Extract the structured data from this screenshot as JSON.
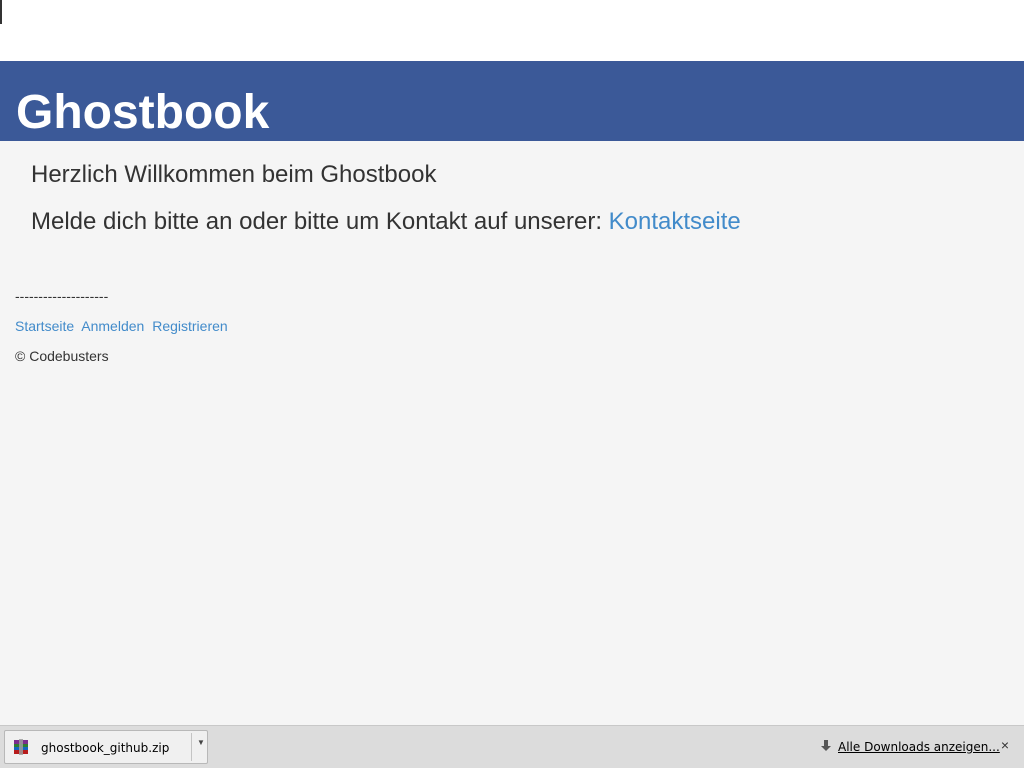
{
  "header": {
    "title": "Ghostbook",
    "background": "#3b5998"
  },
  "main": {
    "welcome": "Herzlich Willkommen beim Ghostbook",
    "login_prompt": "Melde dich bitte an oder bitte um Kontakt auf unserer:",
    "contact_link": "Kontaktseite"
  },
  "footer": {
    "divider": "--------------------",
    "nav": [
      {
        "label": "Startseite"
      },
      {
        "label": "Anmelden"
      },
      {
        "label": "Registrieren"
      }
    ],
    "copyright": "© Codebusters"
  },
  "download_bar": {
    "file": {
      "name": "ghostbook_github.zip",
      "icon": "archive-icon"
    },
    "show_all_label": "Alle Downloads anzeigen...",
    "show_all_icon": "download-arrow-icon",
    "close_icon": "close-icon",
    "close_glyph": "×"
  },
  "colors": {
    "link": "#428bca",
    "text": "#333333",
    "page_background": "#f5f5f5"
  }
}
